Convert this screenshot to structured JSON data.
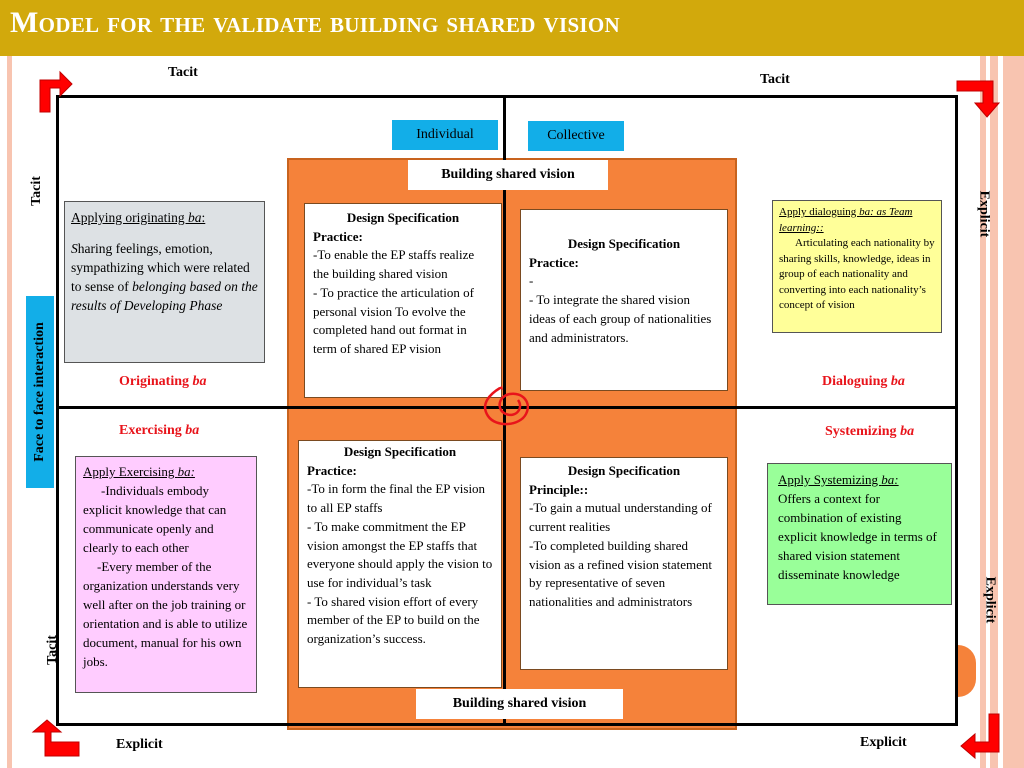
{
  "title": "Model for  the validate building shared vision",
  "colors": {
    "title_bar": "#d2a90c",
    "accent_red": "#e8141b",
    "orange_band": "#f5823a",
    "blue_tag": "#12aee8",
    "gray_box": "#dde1e4",
    "yellow_box": "#ffff99",
    "pink_box": "#ffccff",
    "green_box": "#99ff99"
  },
  "axis_labels": {
    "top_left": "Tacit",
    "top_right": "Tacit",
    "left_top": "Tacit",
    "left_bottom": "Tacit",
    "right_top": "Explicit",
    "right_bottom": "Explicit",
    "bottom_left": "Explicit",
    "bottom_right": "Explicit"
  },
  "side_tag": "Face to face interaction",
  "tags": {
    "individual": "Individual",
    "collective": "Collective"
  },
  "building_shared_vision_top": "Building shared vision",
  "building_shared_vision_bottom": "Building shared vision",
  "quadrant_labels": {
    "originating": {
      "text": "Originating ",
      "ba": "ba"
    },
    "dialoguing": {
      "text": "Dialoguing ",
      "ba": "ba"
    },
    "exercising": {
      "text": "Exercising ",
      "ba": "ba"
    },
    "systemizing": {
      "text": "Systemizing ",
      "ba": "ba"
    }
  },
  "notes": {
    "originating": {
      "heading": "Applying originating ",
      "heading_ba": "ba",
      "heading_end": ":",
      "body_initial": "S",
      "body": "haring feelings, emotion, sympathizing which were related to sense of ",
      "body_italic": "belonging based on the results of Developing Phase"
    },
    "dialoguing": {
      "heading": "Apply dialoguing ",
      "heading_italic": "ba: as Team learning::",
      "body": "Articulating  each nationality by sharing skills, knowledge, ideas in group of each nationality and converting into each nationality’s concept of vision"
    },
    "exercising": {
      "heading": "Apply Exercising ",
      "heading_italic": "ba:",
      "body_1": "-Individuals embody explicit knowledge that can communicate openly and clearly to each other",
      "body_2": "-Every member of the organization understands very well after on the job training or orientation and is able to utilize document, manual for his own jobs."
    },
    "systemizing": {
      "heading": "Apply Systemizing  ",
      "heading_italic": "ba:",
      "body": "Offers a context for combination of existing explicit knowledge in terms of shared vision statement disseminate knowledge"
    }
  },
  "design_specs": {
    "top_left": {
      "heading": "Design Specification",
      "subheading": "Practice:",
      "lines": [
        "-To enable the EP staffs realize the building shared vision",
        "- To practice the articulation of personal vision To evolve the completed hand out format in term of shared EP vision"
      ]
    },
    "top_right": {
      "heading": "Design Specification",
      "subheading": "Practice:",
      "lines": [
        "-",
        "- To integrate the shared vision ideas of each group of nationalities and administrators."
      ]
    },
    "bottom_left": {
      "heading": "Design Specification",
      "subheading": "Practice:",
      "lines": [
        "-To in form the final the EP vision to all EP staffs",
        "- To make commitment the EP vision amongst the EP staffs that  everyone should apply the vision to use for individual’s task",
        "- To shared vision effort of every member of the EP to build on the organization’s success."
      ]
    },
    "bottom_right": {
      "heading": "Design Specification",
      "subheading": "Principle::",
      "lines": [
        "-To gain a mutual understanding of current realities",
        "-To completed building shared vision as a refined vision statement by representative of seven nationalities and administrators"
      ]
    }
  },
  "icons": {
    "corner_arrows": [
      "arrow-top-left-bent-right",
      "arrow-top-right-bent-down",
      "arrow-bottom-right-bent-left",
      "arrow-bottom-left-bent-up"
    ],
    "center_mark": "red-spiral-annotation"
  }
}
